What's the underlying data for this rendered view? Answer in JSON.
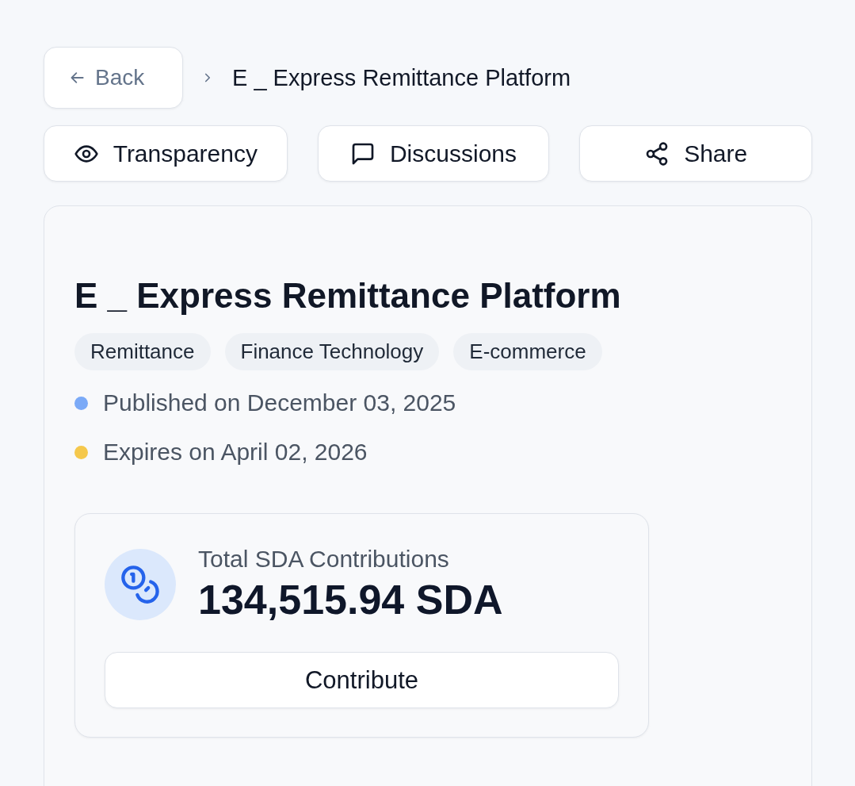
{
  "back_button": {
    "label": "Back"
  },
  "breadcrumb": {
    "current": "E _ Express Remittance Platform"
  },
  "actions": [
    {
      "kind": "eye",
      "label": "Transparency"
    },
    {
      "kind": "chat",
      "label": "Discussions"
    },
    {
      "kind": "share",
      "label": "Share"
    }
  ],
  "project": {
    "title": "E _ Express Remittance Platform",
    "tags": [
      "Remittance",
      "Finance Technology",
      "E-commerce"
    ],
    "dates": [
      {
        "text": "Published on December 03, 2025",
        "color": "#7baaf7"
      },
      {
        "text": "Expires on April 02, 2026",
        "color": "#f5c84c"
      }
    ],
    "contributions": {
      "label": "Total SDA Contributions",
      "amount": "134,515.94 SDA",
      "button": "Contribute"
    }
  }
}
